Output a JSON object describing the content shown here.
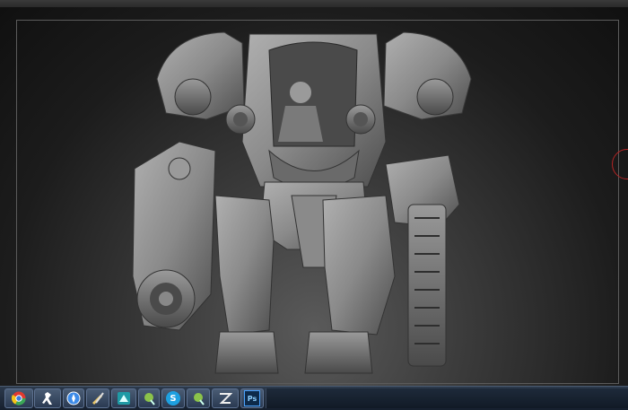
{
  "window": {
    "title": ""
  },
  "viewport": {
    "background_color": "#2a2a2a",
    "frame_color": "#5b5b5b",
    "model_color": "#8a8a8a",
    "gizmo_color": "#b32424",
    "subject": "mech-sculpt-model"
  },
  "taskbar": {
    "items": [
      {
        "name": "chrome-icon",
        "label": ""
      },
      {
        "name": "app-runner-icon",
        "label": ""
      },
      {
        "name": "safari-icon",
        "label": ""
      },
      {
        "name": "tools-icon",
        "label": ""
      },
      {
        "name": "3d-app-icon",
        "label": ""
      },
      {
        "name": "green-app-icon",
        "label": ""
      },
      {
        "name": "skype-icon",
        "label": "S"
      },
      {
        "name": "zbrush-icon",
        "label": ""
      },
      {
        "name": "photoshop-icon",
        "label": "Ps"
      }
    ]
  }
}
